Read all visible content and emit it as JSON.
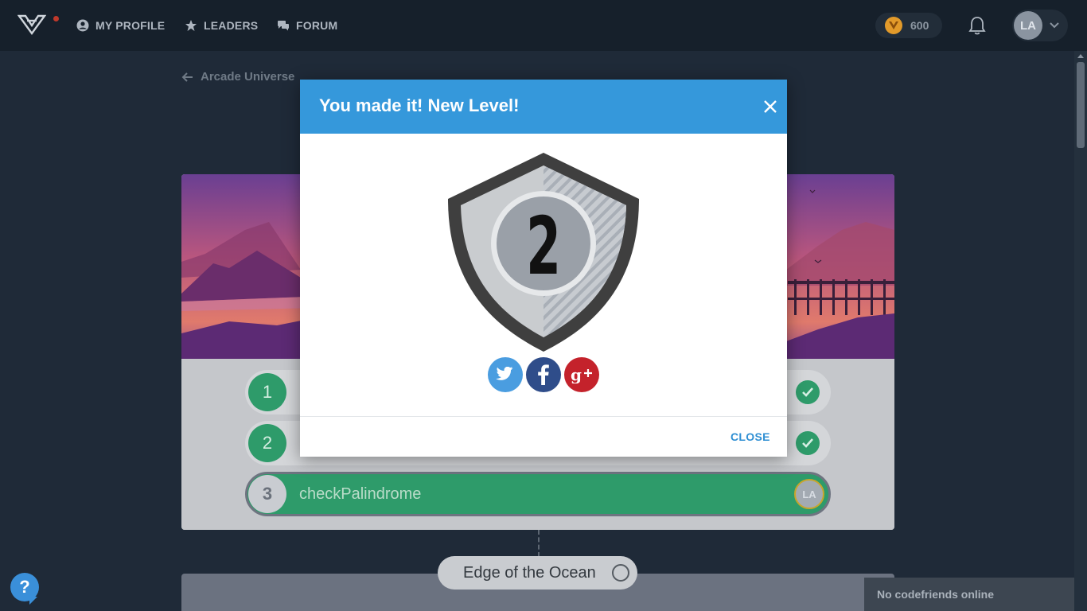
{
  "nav": {
    "my_profile": "MY PROFILE",
    "leaders": "LEADERS",
    "forum": "FORUM",
    "coins": "600",
    "user_initials": "LA"
  },
  "page": {
    "back_label": "Arcade Universe"
  },
  "tasks": [
    {
      "number": "1",
      "status": "completed"
    },
    {
      "number": "2",
      "status": "completed"
    },
    {
      "number": "3",
      "name": "checkPalindrome",
      "status": "active",
      "user_initials": "LA"
    }
  ],
  "next_section": {
    "label": "Edge of the Ocean"
  },
  "modal": {
    "title": "You made it! New Level!",
    "level": "2",
    "close_label": "CLOSE",
    "share": [
      "twitter-icon",
      "facebook-icon",
      "google-plus-icon"
    ]
  },
  "help": {
    "label": "?"
  },
  "chat": {
    "status": "No codefriends online"
  },
  "colors": {
    "header_bg": "#16202b",
    "modal_header": "#3598db",
    "task_green": "#2e9b6a",
    "twitter": "#4a9de0",
    "facebook": "#2f4d8a",
    "google_plus": "#c4222b"
  }
}
